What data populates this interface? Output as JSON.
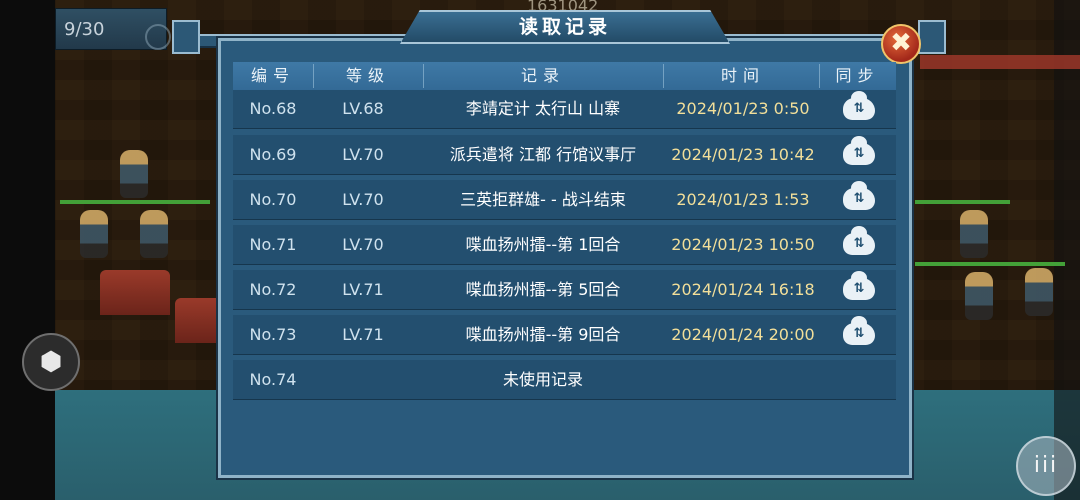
{
  "hud": {
    "page_counter": "9/30",
    "top_number": "1631042"
  },
  "dialog": {
    "title": "读取记录",
    "close_symbol": "✖",
    "headers": {
      "no": "编号",
      "level": "等级",
      "record": "记录",
      "time": "时间",
      "sync": "同步"
    },
    "rows": [
      {
        "no": "No.68",
        "level": "LV.68",
        "record": "李靖定计 太行山 山寨",
        "time": "2024/01/23 0:50",
        "sync_icon": "cloud-upload-icon"
      },
      {
        "no": "No.69",
        "level": "LV.70",
        "record": "派兵遣将 江都 行馆议事厅",
        "time": "2024/01/23 10:42",
        "sync_icon": "cloud-upload-icon"
      },
      {
        "no": "No.70",
        "level": "LV.70",
        "record": "三英拒群雄- - 战斗结束",
        "time": "2024/01/23 1:53",
        "sync_icon": "cloud-upload-icon"
      },
      {
        "no": "No.71",
        "level": "LV.70",
        "record": "喋血扬州擂--第 1回合",
        "time": "2024/01/23 10:50",
        "sync_icon": "cloud-upload-icon"
      },
      {
        "no": "No.72",
        "level": "LV.71",
        "record": "喋血扬州擂--第 5回合",
        "time": "2024/01/24 16:18",
        "sync_icon": "cloud-upload-icon"
      },
      {
        "no": "No.73",
        "level": "LV.71",
        "record": "喋血扬州擂--第 9回合",
        "time": "2024/01/24 20:00",
        "sync_icon": "cloud-upload-icon"
      }
    ],
    "empty_row": {
      "no": "No.74",
      "label": "未使用记录"
    }
  },
  "side": {
    "left_button_icon": "cube-icon",
    "menu_button_icon": "menu-icon"
  }
}
